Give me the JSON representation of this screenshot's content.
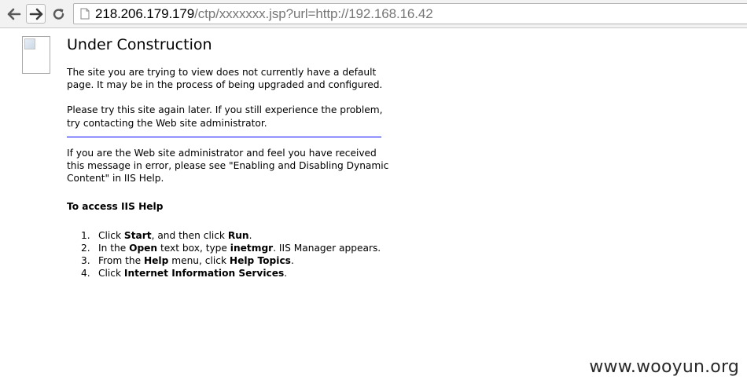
{
  "browser": {
    "url_host": "218.206.179.179",
    "url_path": "/ctp/xxxxxxx.jsp?url=http://192.168.16.42"
  },
  "page": {
    "title": "Under Construction",
    "para1": "The site you are trying to view does not currently have a default page. It may be in the process of being upgraded and configured.",
    "para2": "Please try this site again later. If you still experience the problem, try contacting the Web site administrator.",
    "para3": "If you are the Web site administrator and feel you have received this message in error, please see \"Enabling and Disabling Dynamic Content\" in IIS Help.",
    "help_heading": "To access IIS Help",
    "steps": [
      {
        "num": "1.",
        "parts": [
          [
            "Click ",
            false
          ],
          [
            "Start",
            true
          ],
          [
            ", and then click ",
            false
          ],
          [
            "Run",
            true
          ],
          [
            ".",
            false
          ]
        ]
      },
      {
        "num": "2.",
        "parts": [
          [
            "In the ",
            false
          ],
          [
            "Open",
            true
          ],
          [
            " text box, type ",
            false
          ],
          [
            "inetmgr",
            true
          ],
          [
            ". IIS Manager appears.",
            false
          ]
        ]
      },
      {
        "num": "3.",
        "parts": [
          [
            "From the ",
            false
          ],
          [
            "Help",
            true
          ],
          [
            " menu, click ",
            false
          ],
          [
            "Help Topics",
            true
          ],
          [
            ".",
            false
          ]
        ]
      },
      {
        "num": "4.",
        "parts": [
          [
            "Click ",
            false
          ],
          [
            "Internet Information Services",
            true
          ],
          [
            ".",
            false
          ]
        ]
      }
    ]
  },
  "watermark": "www.wooyun.org",
  "colors": {
    "rule": "#0000ff",
    "url_path": "#777777"
  },
  "icons": {
    "back": "arrow-left-icon",
    "forward": "arrow-right-icon",
    "reload": "reload-icon",
    "page": "document-icon"
  }
}
